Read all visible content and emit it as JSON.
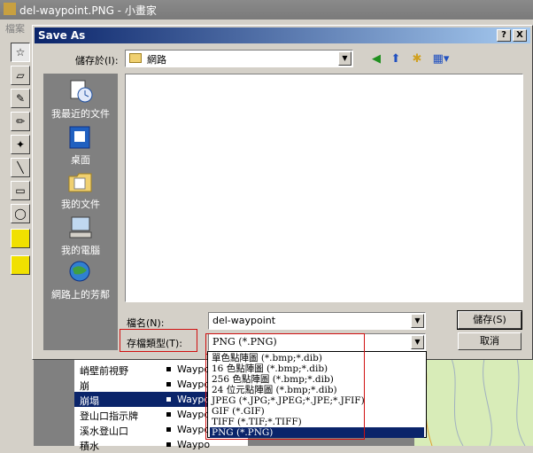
{
  "paint": {
    "title": "del-waypoint.PNG - 小畫家",
    "menu_first": "檔案",
    "list": [
      {
        "name": "峭壁前視野",
        "type": "Waypo"
      },
      {
        "name": "崩",
        "type": "Waypo"
      },
      {
        "name": "崩塌",
        "type": "Waypo"
      },
      {
        "name": "登山口指示牌",
        "type": "Waypo"
      },
      {
        "name": "溪水登山口",
        "type": "Waypo"
      },
      {
        "name": "積水",
        "type": "Waypo"
      }
    ]
  },
  "dialog": {
    "title": "Save As",
    "help": "?",
    "close": "X",
    "save_in_label": "儲存於(I):",
    "save_in_value": "網路",
    "places": [
      {
        "label": "我最近的文件"
      },
      {
        "label": "桌面"
      },
      {
        "label": "我的文件"
      },
      {
        "label": "我的電腦"
      },
      {
        "label": "網路上的芳鄰"
      }
    ],
    "filename_label": "檔名(N):",
    "filename_value": "del-waypoint",
    "filetype_label": "存檔類型(T):",
    "filetype_value": "PNG (*.PNG)",
    "save_button": "儲存(S)",
    "cancel_button": "取消",
    "filetype_options": [
      "單色點陣圖 (*.bmp;*.dib)",
      "16 色點陣圖 (*.bmp;*.dib)",
      "256 色點陣圖 (*.bmp;*.dib)",
      "24 位元點陣圖 (*.bmp;*.dib)",
      "JPEG (*.JPG;*.JPEG;*.JPE;*.JFIF)",
      "GIF (*.GIF)",
      "TIFF (*.TIF;*.TIFF)",
      "PNG (*.PNG)"
    ]
  },
  "colors": {
    "title_active": "#0a246a",
    "highlight": "#0a246a",
    "annotation_red": "#d01010"
  }
}
